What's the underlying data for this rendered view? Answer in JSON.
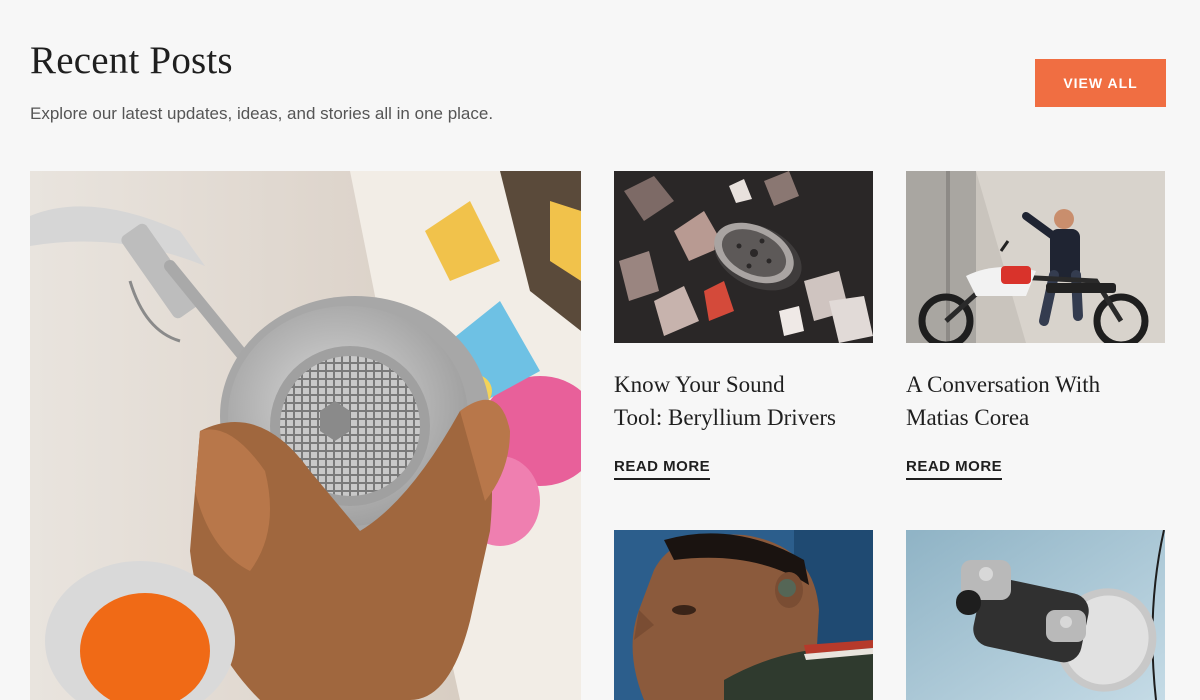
{
  "header": {
    "title": "Recent Posts",
    "subtitle": "Explore our latest updates, ideas, and stories all in one place.",
    "view_all_label": "VIEW ALL"
  },
  "colors": {
    "background": "#f7f7f7",
    "accent": "#f06e42",
    "text": "#1f1f1f"
  },
  "posts": [
    {
      "image": "headphones-in-hand-photo"
    },
    {
      "image": "exploding-driver-render",
      "title_line1": "Know Your Sound",
      "title_line2": "Tool: Beryllium Drivers",
      "cta": "READ MORE"
    },
    {
      "image": "man-on-motorcycle-photo",
      "title_line1": "A Conversation With",
      "title_line2": "Matias Corea",
      "cta": "READ MORE"
    },
    {
      "image": "man-wearing-earbud-photo"
    },
    {
      "image": "earbuds-and-case-photo"
    }
  ]
}
